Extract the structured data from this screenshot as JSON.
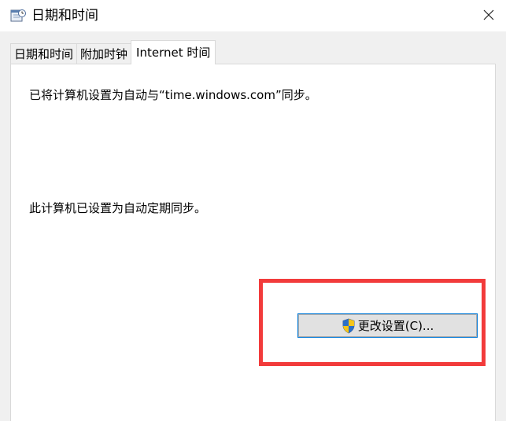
{
  "window": {
    "title": "日期和时间",
    "app_icon": "calendar-clock-icon",
    "close_icon": "close-icon"
  },
  "tabs": [
    {
      "label": "日期和时间",
      "active": false
    },
    {
      "label": "附加时钟",
      "active": false
    },
    {
      "label": "Internet 时间",
      "active": true
    }
  ],
  "panel": {
    "sync_message": "已将计算机设置为自动与“time.windows.com”同步。",
    "schedule_message": "此计算机已设置为自动定期同步。",
    "change_button_label": "更改设置(C)...",
    "change_button_icon": "uac-shield-icon"
  },
  "colors": {
    "highlight_border": "#f23b3b",
    "button_focus_border": "#0078d7",
    "dialog_background": "#f0f0f0"
  }
}
